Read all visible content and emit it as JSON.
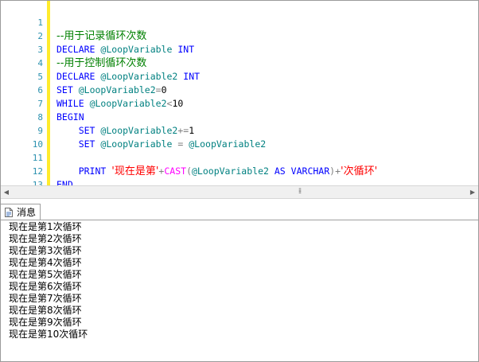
{
  "editor": {
    "line_numbers": [
      "1",
      "2",
      "3",
      "4",
      "5",
      "6",
      "7",
      "8",
      "9",
      "10",
      "11",
      "12",
      "13",
      "14"
    ],
    "line1_comment": "--用于记录循环次数",
    "line2_kw": "DECLARE",
    "line2_var": "@LoopVariable",
    "line2_type": "INT",
    "line3_comment": "--用于控制循环次数",
    "line4_kw": "DECLARE",
    "line4_var": "@LoopVariable2",
    "line4_type": "INT",
    "line5_kw": "SET",
    "line5_var": "@LoopVariable2",
    "line5_op": "=",
    "line5_val": "0",
    "line6_kw": "WHILE",
    "line6_var": "@LoopVariable2",
    "line6_op": "<",
    "line6_val": "10",
    "line7_kw": "BEGIN",
    "line8_kw": "SET",
    "line8_var": "@LoopVariable2",
    "line8_op": "+=",
    "line8_val": "1",
    "line9_kw": "SET",
    "line9_var": "@LoopVariable",
    "line9_op": "=",
    "line9_var2": "@LoopVariable2",
    "line11_kw": "PRINT",
    "line11_str1": "'现在是第'",
    "line11_op1": "+",
    "line11_fn": "CAST",
    "line11_paren_open": "(",
    "line11_var": "@LoopVariable2",
    "line11_as": "AS",
    "line11_type": "VARCHAR",
    "line11_paren_close": ")",
    "line11_op2": "+",
    "line11_str2": "'次循环'",
    "line12_kw": "END"
  },
  "results": {
    "tab_label": "消息",
    "messages": [
      "现在是第1次循环",
      "现在是第2次循环",
      "现在是第3次循环",
      "现在是第4次循环",
      "现在是第5次循环",
      "现在是第6次循环",
      "现在是第7次循环",
      "现在是第8次循环",
      "现在是第9次循环",
      "现在是第10次循环"
    ]
  },
  "colors": {
    "keyword": "#0000ff",
    "variable": "#008080",
    "operator": "#808080",
    "comment": "#008000",
    "string": "#ff0000",
    "function": "#ff00ff",
    "line_number": "#2b91af",
    "change_margin": "#ffeb2c"
  },
  "icons": {
    "tab": "message-page-icon",
    "scroll_left": "arrow-left-icon",
    "scroll_right": "arrow-right-icon",
    "scroll_grip": "grip-icon"
  }
}
